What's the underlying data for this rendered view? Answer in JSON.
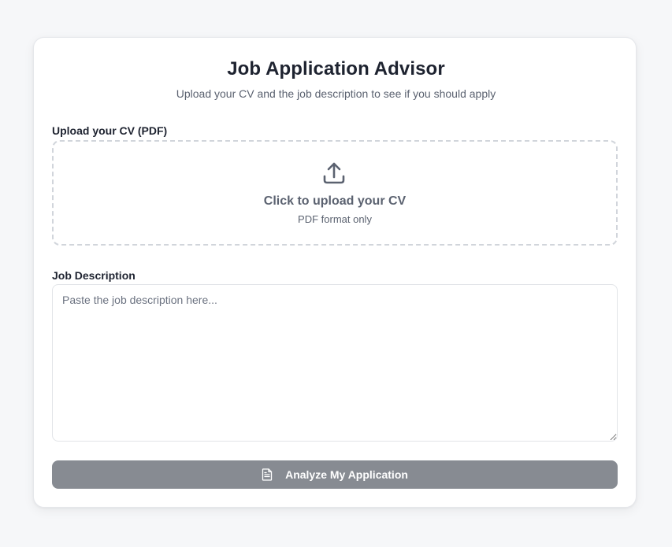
{
  "header": {
    "title": "Job Application Advisor",
    "subtitle": "Upload your CV and the job description to see if you should apply"
  },
  "cv_upload": {
    "label": "Upload your CV (PDF)",
    "icon": "upload-icon",
    "prompt": "Click to upload your CV",
    "hint": "PDF format only"
  },
  "job_description": {
    "label": "Job Description",
    "placeholder": "Paste the job description here...",
    "value": ""
  },
  "analyze_button": {
    "icon": "document-icon",
    "label": "Analyze My Application",
    "disabled": true
  },
  "colors": {
    "page_background": "#f6f7f9",
    "card_background": "#ffffff",
    "button_disabled": "#878b92",
    "text_primary": "#1e2330",
    "text_muted": "#5b6270"
  }
}
